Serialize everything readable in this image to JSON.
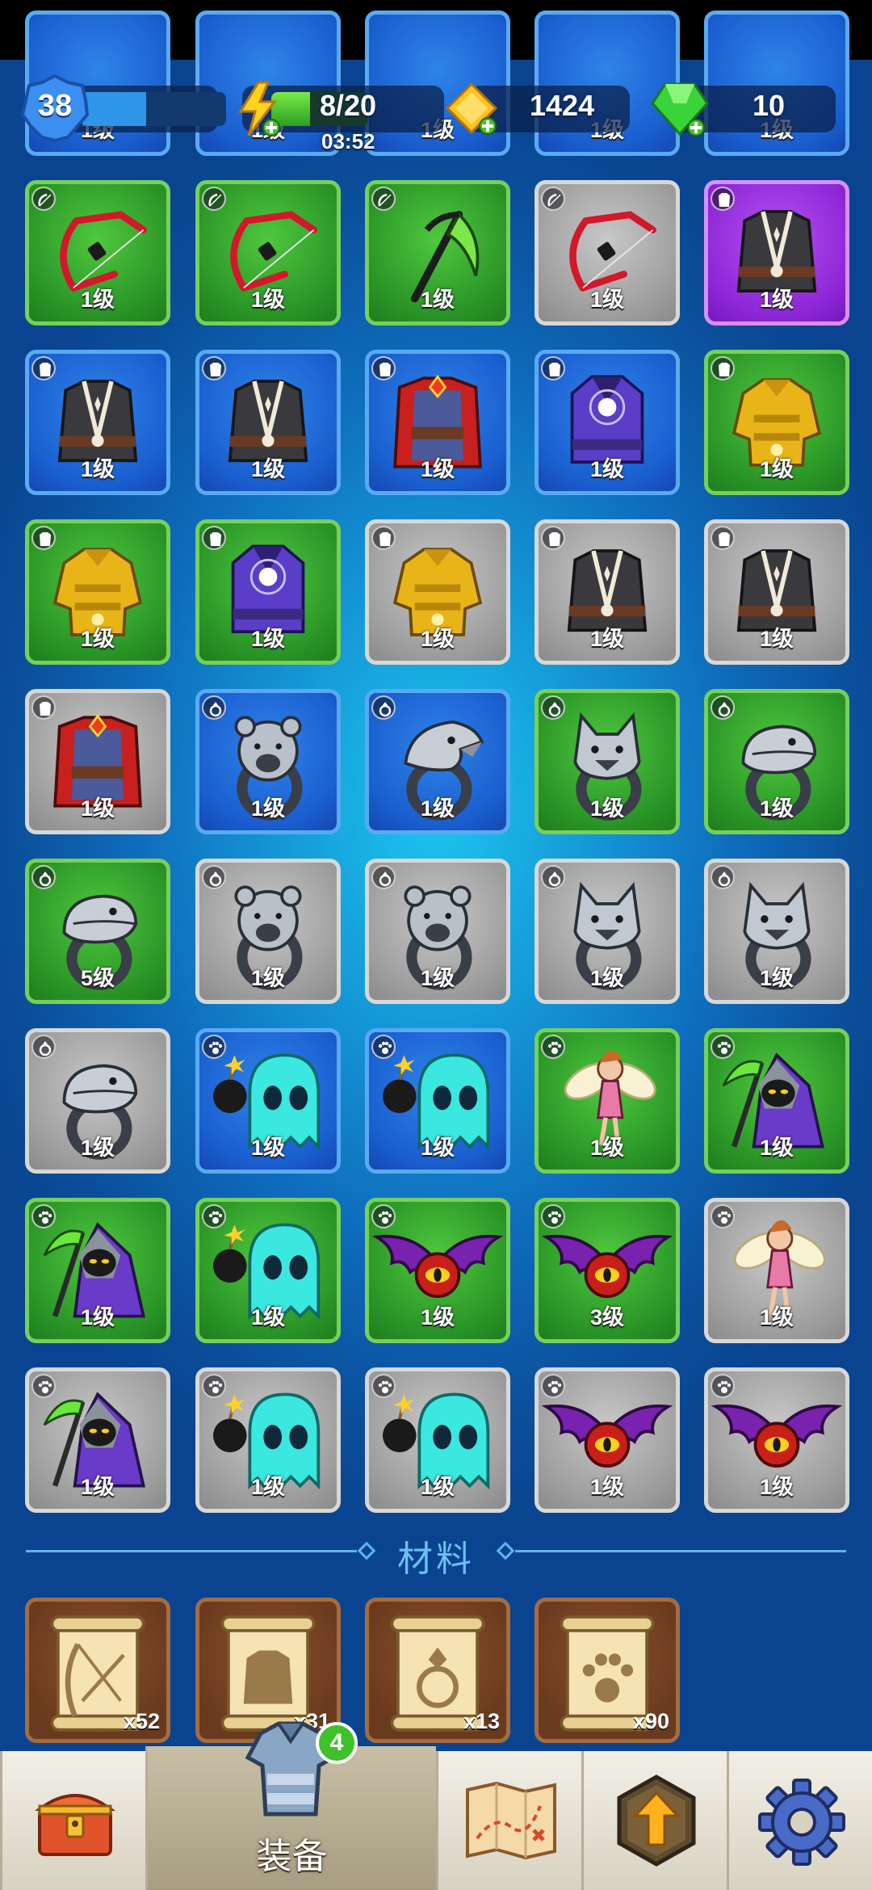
{
  "hud": {
    "player_level": "38",
    "xp_progress": 0.45,
    "energy": "8/20",
    "energy_progress": 0.4,
    "energy_timer": "03:52",
    "gold": "1424",
    "gems": "10"
  },
  "top_partial_row": [
    "1级",
    "1级",
    "1级",
    "1级",
    "1级"
  ],
  "inventory": [
    [
      {
        "type": "bow",
        "rarity": "green",
        "level": "1级"
      },
      {
        "type": "bow",
        "rarity": "green",
        "level": "1级"
      },
      {
        "type": "scythe",
        "rarity": "green",
        "level": "1级"
      },
      {
        "type": "bow",
        "rarity": "gray",
        "level": "1级"
      },
      {
        "type": "vest",
        "rarity": "purple",
        "level": "1级"
      }
    ],
    [
      {
        "type": "vest",
        "rarity": "blue",
        "level": "1级"
      },
      {
        "type": "vest",
        "rarity": "blue",
        "level": "1级"
      },
      {
        "type": "red-robe",
        "rarity": "blue",
        "level": "1级"
      },
      {
        "type": "mage-robe",
        "rarity": "blue",
        "level": "1级"
      },
      {
        "type": "gold-armor",
        "rarity": "green",
        "level": "1级"
      }
    ],
    [
      {
        "type": "gold-armor",
        "rarity": "green",
        "level": "1级"
      },
      {
        "type": "mage-robe",
        "rarity": "green",
        "level": "1级"
      },
      {
        "type": "gold-armor",
        "rarity": "gray",
        "level": "1级"
      },
      {
        "type": "vest",
        "rarity": "gray",
        "level": "1级"
      },
      {
        "type": "vest",
        "rarity": "gray",
        "level": "1级"
      }
    ],
    [
      {
        "type": "red-robe",
        "rarity": "gray",
        "level": "1级"
      },
      {
        "type": "bear-ring",
        "rarity": "blue",
        "level": "1级"
      },
      {
        "type": "eagle-ring",
        "rarity": "blue",
        "level": "1级"
      },
      {
        "type": "wolf-ring",
        "rarity": "green",
        "level": "1级"
      },
      {
        "type": "snake-ring",
        "rarity": "green",
        "level": "1级"
      }
    ],
    [
      {
        "type": "snake-ring",
        "rarity": "green",
        "level": "5级"
      },
      {
        "type": "bear-ring",
        "rarity": "gray",
        "level": "1级"
      },
      {
        "type": "bear-ring",
        "rarity": "gray",
        "level": "1级"
      },
      {
        "type": "wolf-ring",
        "rarity": "gray",
        "level": "1级"
      },
      {
        "type": "wolf-ring",
        "rarity": "gray",
        "level": "1级"
      }
    ],
    [
      {
        "type": "snake-ring",
        "rarity": "gray",
        "level": "1级"
      },
      {
        "type": "ghost",
        "rarity": "blue",
        "level": "1级"
      },
      {
        "type": "ghost",
        "rarity": "blue",
        "level": "1级"
      },
      {
        "type": "fairy",
        "rarity": "green",
        "level": "1级"
      },
      {
        "type": "reaper",
        "rarity": "green",
        "level": "1级"
      }
    ],
    [
      {
        "type": "reaper",
        "rarity": "green",
        "level": "1级"
      },
      {
        "type": "ghost",
        "rarity": "green",
        "level": "1级"
      },
      {
        "type": "bat",
        "rarity": "green",
        "level": "1级"
      },
      {
        "type": "bat",
        "rarity": "green",
        "level": "3级"
      },
      {
        "type": "fairy",
        "rarity": "gray",
        "level": "1级"
      }
    ],
    [
      {
        "type": "reaper",
        "rarity": "gray",
        "level": "1级"
      },
      {
        "type": "ghost",
        "rarity": "gray",
        "level": "1级"
      },
      {
        "type": "ghost",
        "rarity": "gray",
        "level": "1级"
      },
      {
        "type": "bat",
        "rarity": "gray",
        "level": "1级"
      },
      {
        "type": "bat",
        "rarity": "gray",
        "level": "1级"
      }
    ]
  ],
  "materials_title": "材料",
  "materials": [
    {
      "icon": "bow-scroll-icon",
      "count": "x52"
    },
    {
      "icon": "armor-scroll-icon",
      "count": "x31"
    },
    {
      "icon": "ring-scroll-icon",
      "count": "x13"
    },
    {
      "icon": "paw-scroll-icon",
      "count": "x90"
    }
  ],
  "nav": {
    "equipment_label": "装备",
    "equipment_badge": "4"
  },
  "colors": {
    "green": "#2a9527",
    "blue": "#1a5fd0",
    "gray": "#9e9e9e",
    "purple": "#8e28d8"
  }
}
